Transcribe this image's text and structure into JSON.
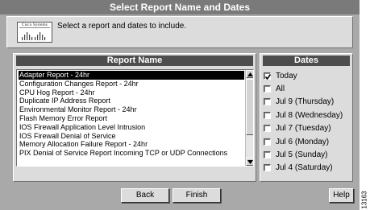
{
  "window": {
    "title": "Select Report Name and Dates"
  },
  "header": {
    "logo_text": "Cisco Systems",
    "intro": "Select a report and dates to include."
  },
  "reports": {
    "header": "Report Name",
    "selected_index": 0,
    "items": [
      "Adapter Report - 24hr",
      "Configuration Changes Report - 24hr",
      "CPU Hog Report - 24hr",
      "Duplicate IP Address Report",
      "Environmental Monitor Report - 24hr",
      "Flash Memory Error Report",
      "IOS Firewall Application Level Intrusion",
      "IOS Firewall Denial of Service",
      "Memory Allocation Failure Report - 24hr",
      "PIX Denial of Service Report Incoming TCP or UDP Connections"
    ]
  },
  "dates": {
    "header": "Dates",
    "items": [
      {
        "label": "Today",
        "checked": true
      },
      {
        "label": "All",
        "checked": false
      },
      {
        "label": "Jul 9 (Thursday)",
        "checked": false
      },
      {
        "label": "Jul 8 (Wednesday)",
        "checked": false
      },
      {
        "label": "Jul 7 (Tuesday)",
        "checked": false
      },
      {
        "label": "Jul 6 (Monday)",
        "checked": false
      },
      {
        "label": "Jul 5 (Sunday)",
        "checked": false
      },
      {
        "label": "Jul 4 (Saturday)",
        "checked": false
      }
    ]
  },
  "buttons": {
    "back": "Back",
    "finish": "Finish",
    "help": "Help"
  },
  "figure_id": "13163",
  "icons": {
    "logo": "cisco-logo-icon",
    "scroll_up": "arrow-up-icon",
    "scroll_down": "arrow-down-icon",
    "check": "checkmark-icon"
  }
}
